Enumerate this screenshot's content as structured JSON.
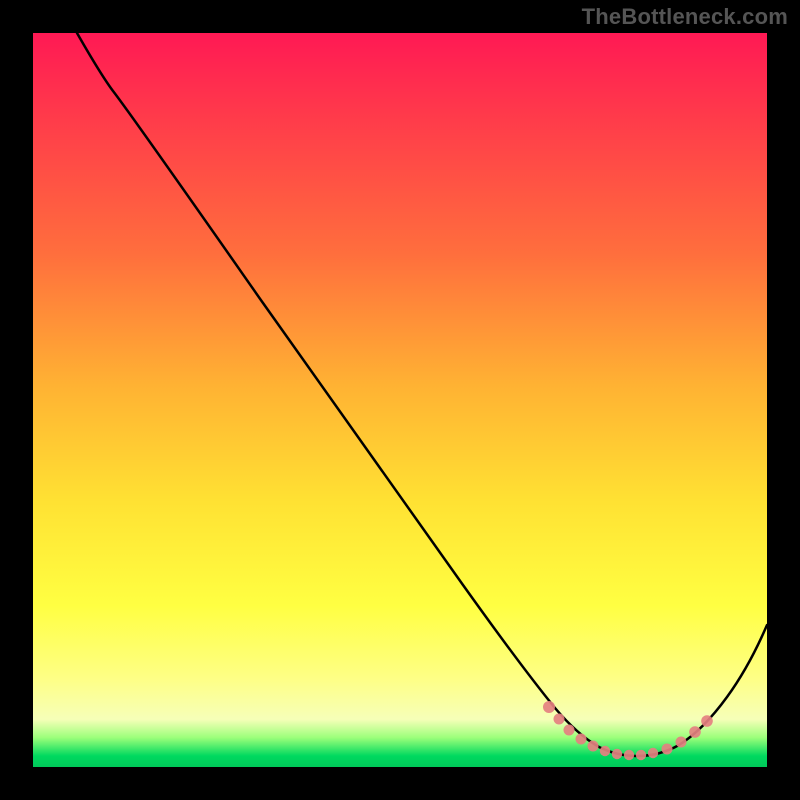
{
  "watermark": "TheBottleneck.com",
  "chart_data": {
    "type": "line",
    "title": "",
    "xlabel": "",
    "ylabel": "",
    "xlim": [
      0,
      100
    ],
    "ylim": [
      0,
      100
    ],
    "grid": false,
    "series": [
      {
        "name": "curve",
        "x": [
          6,
          10,
          20,
          30,
          40,
          50,
          58,
          62,
          66,
          70,
          74,
          78,
          82,
          85,
          88,
          91,
          94,
          97,
          100
        ],
        "y": [
          100,
          94,
          80,
          66,
          52,
          38,
          26,
          19,
          13,
          8,
          5,
          3,
          2,
          2,
          3,
          5,
          9,
          15,
          23
        ],
        "color": "#000000"
      },
      {
        "name": "markers",
        "x": [
          70,
          72,
          74,
          76,
          78,
          80,
          82,
          84,
          86,
          88,
          90,
          92
        ],
        "y": [
          7.5,
          5.5,
          4.3,
          3.3,
          2.7,
          2.3,
          2.1,
          2.2,
          2.7,
          3.5,
          4.7,
          6.5
        ],
        "color": "#e06666"
      }
    ],
    "gradient_stops": [
      {
        "pos": 0,
        "color": "#ff1954"
      },
      {
        "pos": 30,
        "color": "#ff6e3d"
      },
      {
        "pos": 64,
        "color": "#ffe233"
      },
      {
        "pos": 93,
        "color": "#f6ffb8"
      },
      {
        "pos": 100,
        "color": "#00c95a"
      }
    ]
  }
}
